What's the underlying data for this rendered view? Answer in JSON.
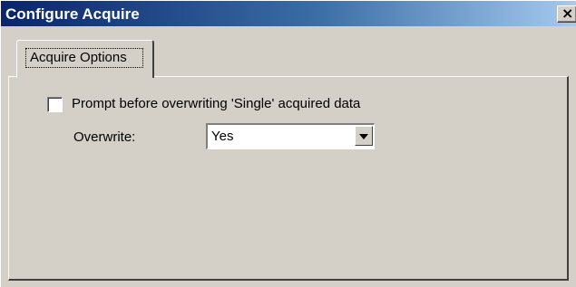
{
  "window": {
    "title": "Configure Acquire",
    "close_glyph": "×",
    "colors": {
      "titlebar_start": "#0a246a",
      "titlebar_end": "#a6caf0",
      "face": "#d4d0c8"
    }
  },
  "tabs": [
    {
      "label": "Acquire Options",
      "selected": true
    }
  ],
  "options": {
    "prompt_checkbox": {
      "label": "Prompt before overwriting 'Single' acquired data",
      "checked": false
    },
    "overwrite": {
      "label": "Overwrite:",
      "value": "Yes"
    }
  }
}
